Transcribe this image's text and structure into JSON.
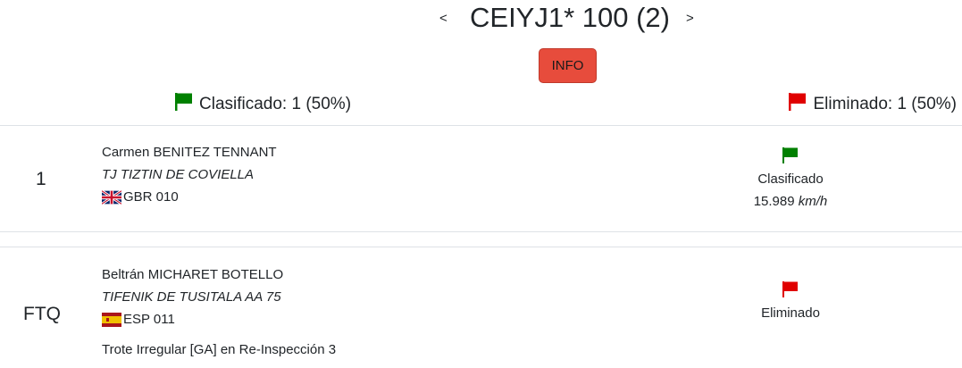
{
  "header": {
    "prev_label": "<",
    "next_label": ">",
    "title": "CEIYJ1* 100 (2)",
    "info_label": "INFO"
  },
  "summary": {
    "classified": "Clasificado: 1 (50%)",
    "classified_color": "#008000",
    "eliminated": "Eliminado: 1 (50%)",
    "eliminated_color": "#e00000"
  },
  "results": [
    {
      "rank": "1",
      "rider": "Carmen BENITEZ TENNANT",
      "horse": "TJ TIZTIN DE COVIELLA",
      "country_code": "GBR 010",
      "flag_icon": "uk-flag-icon",
      "status": "Clasificado",
      "status_color": "#008000",
      "speed_value": "15.989",
      "speed_unit": "km/h"
    },
    {
      "rank": "FTQ",
      "rider": "Beltrán MICHARET BOTELLO",
      "horse": "TIFENIK DE TUSITALA AA 75",
      "country_code": "ESP 011",
      "flag_icon": "spain-flag-icon",
      "status": "Eliminado",
      "status_color": "#e00000",
      "note": "Trote Irregular [GA] en Re-Inspección 3"
    }
  ]
}
